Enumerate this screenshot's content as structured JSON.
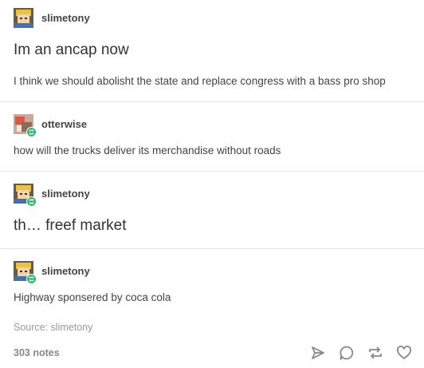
{
  "posts": [
    {
      "username": "slimetony",
      "title": "Im an ancap now",
      "body": "I think we should abolisht the state and replace congress with a bass pro shop"
    },
    {
      "username": "otterwise",
      "body": "how will the trucks deliver its merchandise without roads"
    },
    {
      "username": "slimetony",
      "title": "th… freef market"
    },
    {
      "username": "slimetony",
      "body": "Highway sponsered by coca cola"
    }
  ],
  "footer": {
    "source": "Source: slimetony",
    "notes": "303 notes"
  },
  "icons": {
    "share": "share-icon",
    "reply": "reply-icon",
    "reblog": "reblog-icon",
    "like": "heart-icon"
  },
  "colors": {
    "reblog_badge": "#3cb371"
  }
}
